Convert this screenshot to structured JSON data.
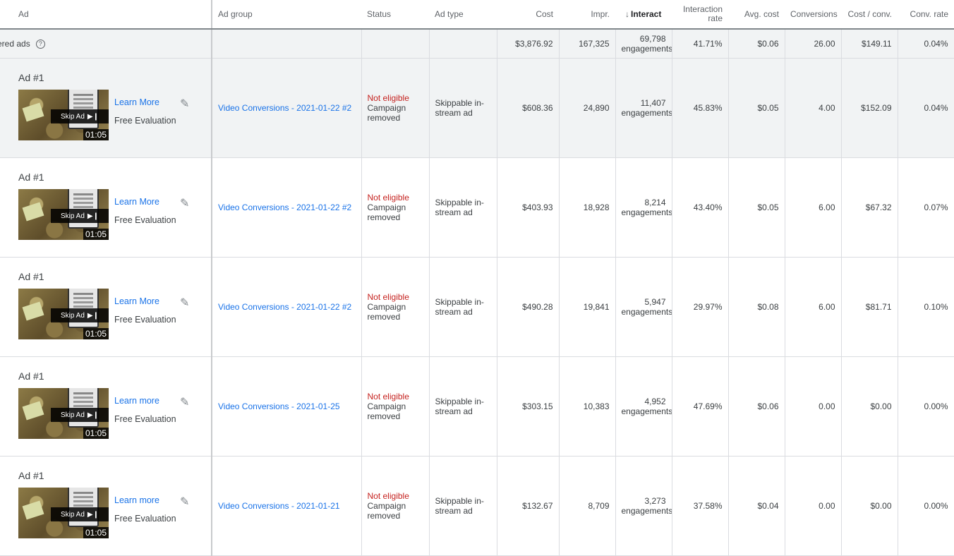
{
  "columns": {
    "ad": "Ad",
    "ad_group": "Ad group",
    "status": "Status",
    "ad_type": "Ad type",
    "cost": "Cost",
    "impr": "Impr.",
    "interactions": "Interact",
    "interaction_rate": "Interaction rate",
    "avg_cost": "Avg. cost",
    "conversions": "Conversions",
    "cost_conv": "Cost / conv.",
    "conv_rate": "Conv. rate"
  },
  "total": {
    "label": "ered ads",
    "cost": "$3,876.92",
    "impr": "167,325",
    "interactions": "69,798",
    "interactions_unit": "engagements",
    "interaction_rate": "41.71%",
    "avg_cost": "$0.06",
    "conversions": "26.00",
    "cost_conv": "$149.11",
    "conv_rate": "0.04%"
  },
  "rows": [
    {
      "ad_name": "Ad #1",
      "cta": "Learn More",
      "description": "Free Evaluation",
      "skip": "Skip Ad",
      "duration": "01:05",
      "ad_group": "Video Conversions - 2021-01-22 #2",
      "status_main": "Not eligible",
      "status_sub": "Campaign removed",
      "ad_type": "Skippable in-stream ad",
      "cost": "$608.36",
      "impr": "24,890",
      "interactions": "11,407",
      "interactions_unit": "engagements",
      "interaction_rate": "45.83%",
      "avg_cost": "$0.05",
      "conversions": "4.00",
      "cost_conv": "$152.09",
      "conv_rate": "0.04%"
    },
    {
      "ad_name": "Ad #1",
      "cta": "Learn More",
      "description": "Free Evaluation",
      "skip": "Skip Ad",
      "duration": "01:05",
      "ad_group": "Video Conversions - 2021-01-22 #2",
      "status_main": "Not eligible",
      "status_sub": "Campaign removed",
      "ad_type": "Skippable in-stream ad",
      "cost": "$403.93",
      "impr": "18,928",
      "interactions": "8,214",
      "interactions_unit": "engagements",
      "interaction_rate": "43.40%",
      "avg_cost": "$0.05",
      "conversions": "6.00",
      "cost_conv": "$67.32",
      "conv_rate": "0.07%"
    },
    {
      "ad_name": "Ad #1",
      "cta": "Learn More",
      "description": "Free Evaluation",
      "skip": "Skip Ad",
      "duration": "01:05",
      "ad_group": "Video Conversions - 2021-01-22 #2",
      "status_main": "Not eligible",
      "status_sub": "Campaign removed",
      "ad_type": "Skippable in-stream ad",
      "cost": "$490.28",
      "impr": "19,841",
      "interactions": "5,947",
      "interactions_unit": "engagements",
      "interaction_rate": "29.97%",
      "avg_cost": "$0.08",
      "conversions": "6.00",
      "cost_conv": "$81.71",
      "conv_rate": "0.10%"
    },
    {
      "ad_name": "Ad #1",
      "cta": "Learn more",
      "description": "Free Evaluation",
      "skip": "Skip Ad",
      "duration": "01:05",
      "ad_group": "Video Conversions - 2021-01-25",
      "status_main": "Not eligible",
      "status_sub": "Campaign removed",
      "ad_type": "Skippable in-stream ad",
      "cost": "$303.15",
      "impr": "10,383",
      "interactions": "4,952",
      "interactions_unit": "engagements",
      "interaction_rate": "47.69%",
      "avg_cost": "$0.06",
      "conversions": "0.00",
      "cost_conv": "$0.00",
      "conv_rate": "0.00%"
    },
    {
      "ad_name": "Ad #1",
      "cta": "Learn more",
      "description": "Free Evaluation",
      "skip": "Skip Ad",
      "duration": "01:05",
      "ad_group": "Video Conversions - 2021-01-21",
      "status_main": "Not eligible",
      "status_sub": "Campaign removed",
      "ad_type": "Skippable in-stream ad",
      "cost": "$132.67",
      "impr": "8,709",
      "interactions": "3,273",
      "interactions_unit": "engagements",
      "interaction_rate": "37.58%",
      "avg_cost": "$0.04",
      "conversions": "0.00",
      "cost_conv": "$0.00",
      "conv_rate": "0.00%"
    }
  ],
  "icons": {
    "help": "help-circle-icon",
    "edit": "pencil-icon",
    "sort": "arrow-down-icon",
    "skip": "skip-next-icon"
  }
}
